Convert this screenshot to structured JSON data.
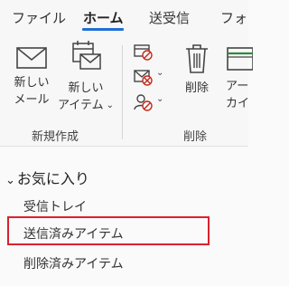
{
  "tabs": [
    {
      "label": "ファイル"
    },
    {
      "label": "ホーム"
    },
    {
      "label": "送受信"
    },
    {
      "label": "フォ"
    }
  ],
  "ribbon": {
    "new_group": {
      "new_mail": {
        "line1": "新しい",
        "line2": "メール"
      },
      "new_item": {
        "line1": "新しい",
        "line2": "アイテム"
      },
      "label": "新規作成"
    },
    "delete_group": {
      "delete_button": "削除",
      "archive_button": {
        "line1": "アー",
        "line2": "カイ"
      },
      "label": "削除"
    }
  },
  "favorites": {
    "header": "お気に入り",
    "items": [
      {
        "label": "受信トレイ"
      },
      {
        "label": "送信済みアイテム"
      },
      {
        "label": "削除済みアイテム"
      }
    ],
    "highlight_color": "#d9222e"
  },
  "colors": {
    "accent": "#1f6fd6"
  }
}
